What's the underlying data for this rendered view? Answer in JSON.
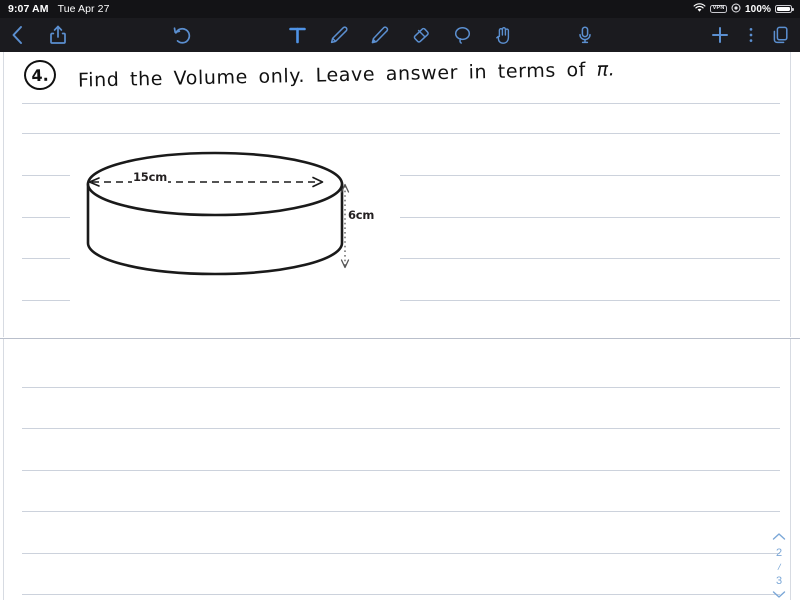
{
  "status_bar": {
    "time": "9:07 AM",
    "date": "Tue Apr 27",
    "wifi_icon": "wifi-icon",
    "vpn_label": "VPN",
    "location_icon": "location-icon",
    "battery_percent": "100%",
    "battery_icon": "battery-icon"
  },
  "toolbar": {
    "back_icon": "back-chevron-icon",
    "share_icon": "share-icon",
    "undo_icon": "undo-icon",
    "text_tool_icon": "text-tool-icon",
    "pen_tool_icon": "pen-icon",
    "highlighter_tool_icon": "highlighter-icon",
    "eraser_tool_icon": "eraser-icon",
    "lasso_tool_icon": "lasso-icon",
    "hand_tool_icon": "hand-icon",
    "mic_icon": "microphone-icon",
    "add_icon": "plus-icon",
    "more_icon": "more-vertical-icon",
    "pages_icon": "pages-icon",
    "active_tool": "text-tool-icon"
  },
  "note": {
    "question_number": "4.",
    "question_text": "Find the Volume only.   Leave answer in terms of ",
    "question_symbol": "π.",
    "figure": {
      "shape_name": "cylinder-diagram",
      "diameter_label": "15cm",
      "height_label": "6cm"
    }
  },
  "page_nav": {
    "up_icon": "chevron-up-icon",
    "current_page": "2",
    "separator": "/",
    "total_pages": "3",
    "down_icon": "chevron-down-icon"
  },
  "colors": {
    "toolbar_bg": "#1b1b1f",
    "statusbar_bg": "#131316",
    "tool_blue": "#5b8fd0",
    "active_blue": "#4f93e6",
    "rule_line": "#ccd2dc",
    "page_nav": "#7ba7d7"
  }
}
